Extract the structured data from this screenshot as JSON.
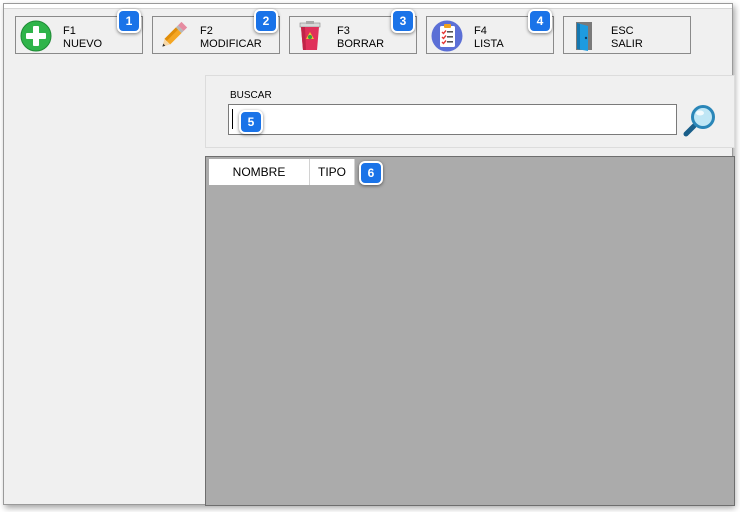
{
  "toolbar": {
    "buttons": [
      {
        "key": "F1",
        "label": "NUEVO",
        "icon": "plus-circle-icon",
        "badge": "1"
      },
      {
        "key": "F2",
        "label": "MODIFICAR",
        "icon": "pencil-icon",
        "badge": "2"
      },
      {
        "key": "F3",
        "label": "BORRAR",
        "icon": "recycle-bin-icon",
        "badge": "3"
      },
      {
        "key": "F4",
        "label": "LISTA",
        "icon": "checklist-icon",
        "badge": "4"
      },
      {
        "key": "ESC",
        "label": "SALIR",
        "icon": "exit-door-icon",
        "badge": ""
      }
    ]
  },
  "search": {
    "label": "BUSCAR",
    "value": "",
    "badge": "5",
    "button_icon": "magnifier-icon"
  },
  "grid": {
    "columns": [
      "NOMBRE",
      "TIPO"
    ],
    "badge": "6",
    "rows": []
  },
  "colors": {
    "badge": "#1a73e8",
    "window_bg": "#f0f0f0",
    "grid_bg": "#ababab"
  }
}
